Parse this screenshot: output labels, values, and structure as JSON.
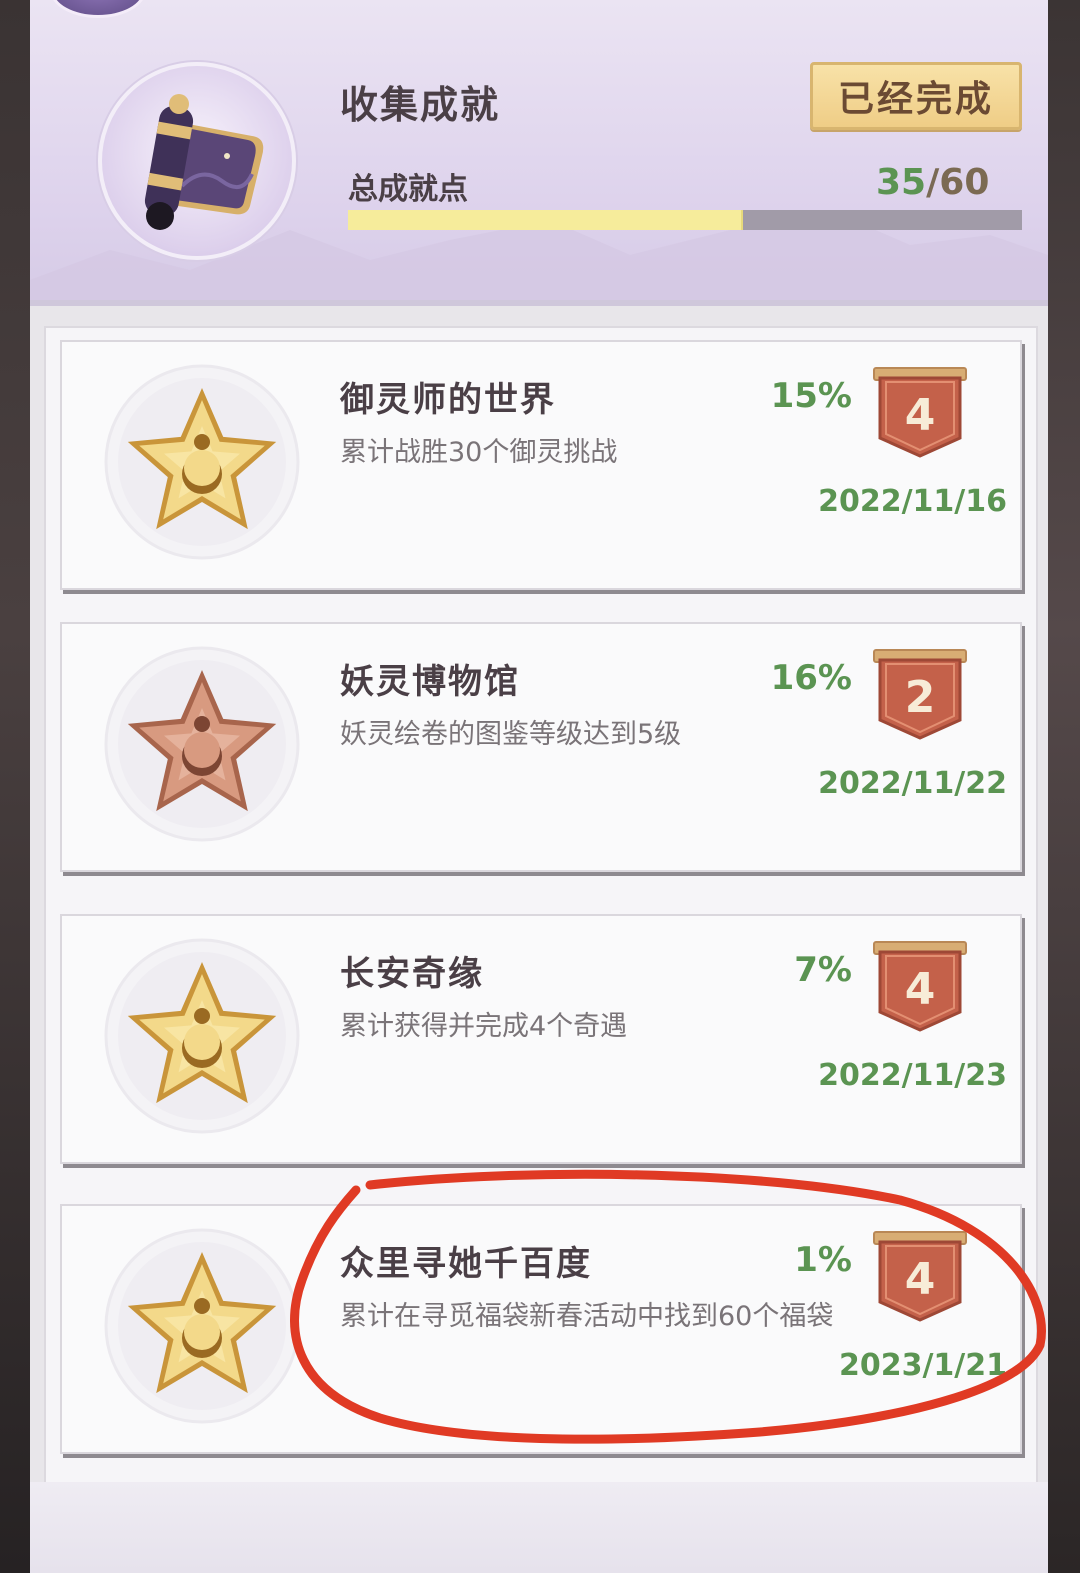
{
  "header": {
    "title": "收集成就",
    "completed_button": "已经完成",
    "total_label": "总成就点",
    "total_current": "35",
    "total_separator": "/",
    "total_max": "60",
    "progress_fraction": 0.583
  },
  "achievements": [
    {
      "name": "御灵师的世界",
      "desc": "累计战胜30个御灵挑战",
      "percent": "15%",
      "badge": "4",
      "date": "2022/11/16",
      "star": "gold"
    },
    {
      "name": "妖灵博物馆",
      "desc": "妖灵绘卷的图鉴等级达到5级",
      "percent": "16%",
      "badge": "2",
      "date": "2022/11/22",
      "star": "bronze"
    },
    {
      "name": "长安奇缘",
      "desc": "累计获得并完成4个奇遇",
      "percent": "7%",
      "badge": "4",
      "date": "2022/11/23",
      "star": "gold"
    },
    {
      "name": "众里寻她千百度",
      "desc": "累计在寻觅福袋新春活动中找到60个福袋",
      "percent": "1%",
      "badge": "4",
      "date": "2023/1/21",
      "star": "gold"
    }
  ],
  "colors": {
    "accent_green": "#5b9452",
    "ribbon": "#c4614a",
    "annotation_red": "#e03a24"
  }
}
